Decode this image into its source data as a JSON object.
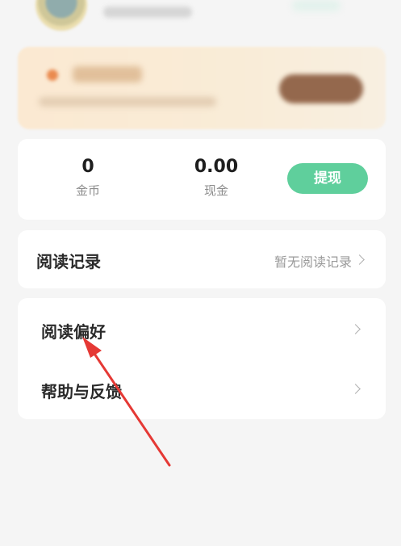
{
  "balance": {
    "coins_value": "0",
    "coins_label": "金币",
    "cash_value": "0.00",
    "cash_label": "现金",
    "withdraw_label": "提现"
  },
  "reading_record": {
    "title": "阅读记录",
    "value": "暂无阅读记录"
  },
  "menu": {
    "items": [
      {
        "label": "阅读偏好"
      },
      {
        "label": "帮助与反馈"
      }
    ]
  },
  "colors": {
    "accent": "#5fcf9c",
    "annotation_arrow": "#e53935",
    "background": "#f5f5f5"
  },
  "icons": [
    "chevron-right-icon",
    "red-arrow-annotation"
  ]
}
